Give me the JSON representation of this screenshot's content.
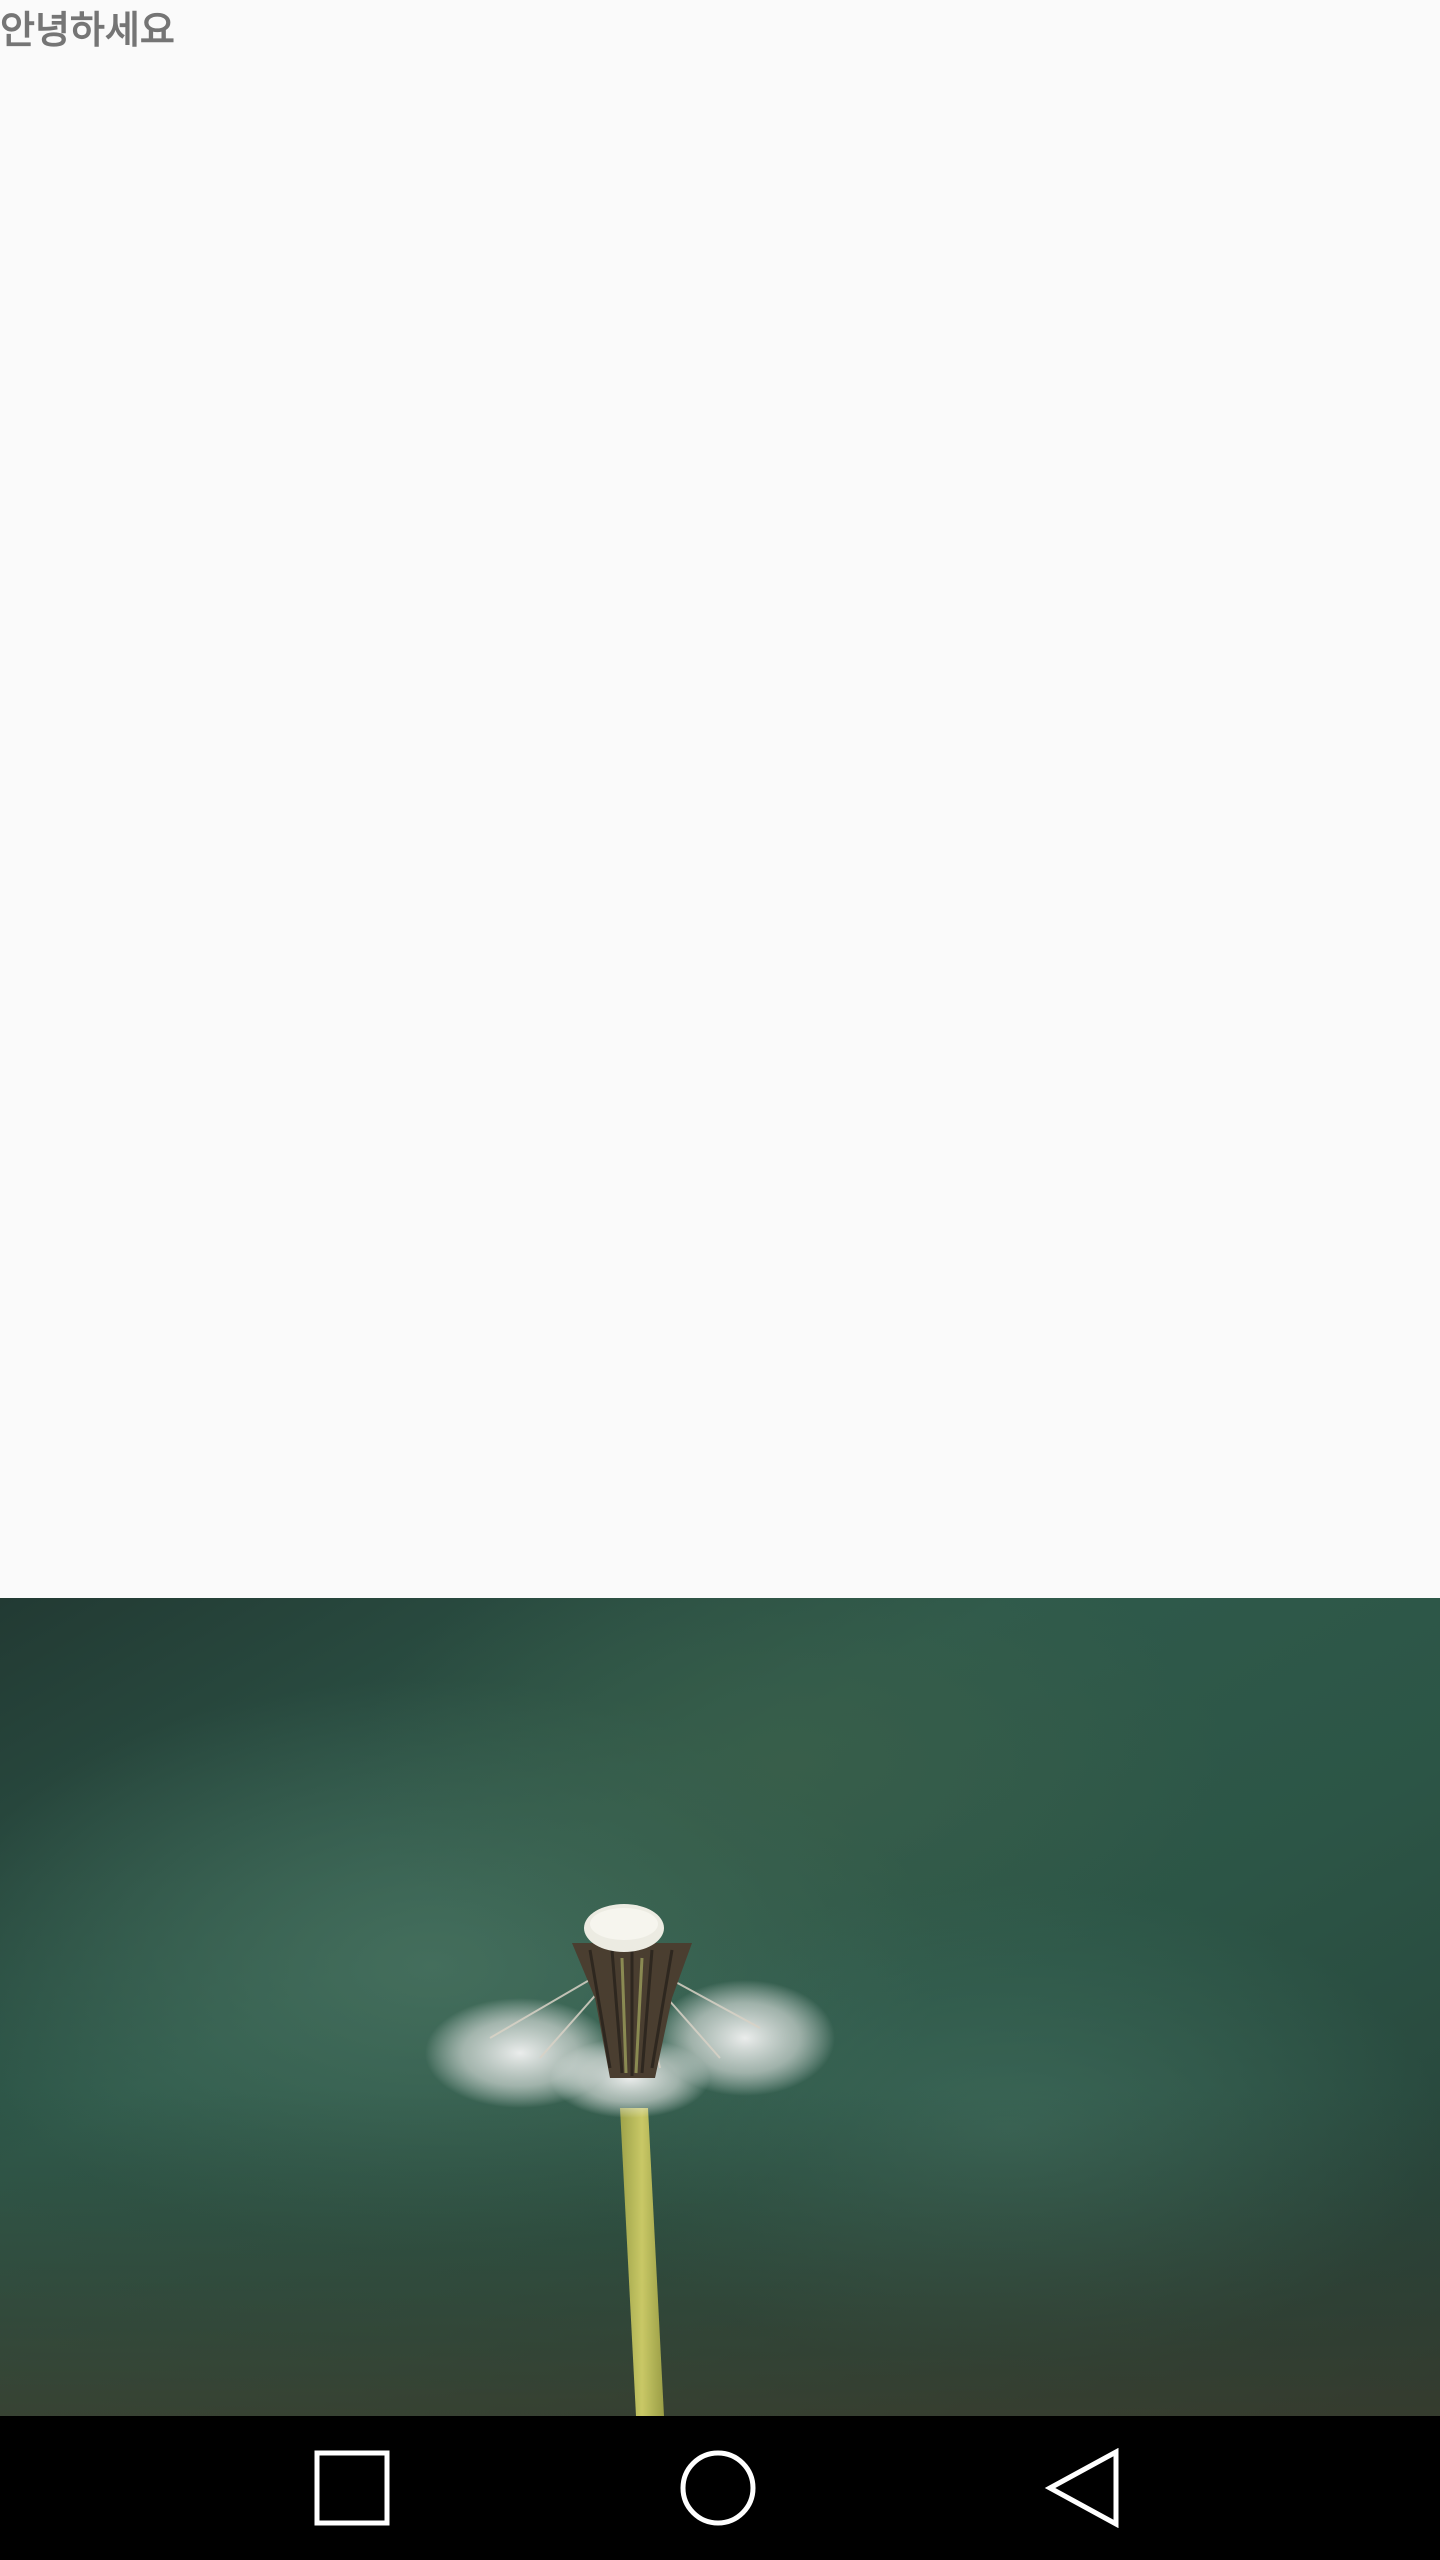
{
  "app": {
    "greeting_text": "안녕하세요"
  },
  "image": {
    "subject": "dandelion",
    "background_color": "#2d4f44",
    "stem_color": "#c2c25a"
  },
  "nav_bar": {
    "background_color": "#000000",
    "icon_color": "#ffffff",
    "buttons": [
      {
        "name": "recents",
        "icon": "square-icon"
      },
      {
        "name": "home",
        "icon": "circle-icon"
      },
      {
        "name": "back",
        "icon": "triangle-back-icon"
      }
    ]
  }
}
